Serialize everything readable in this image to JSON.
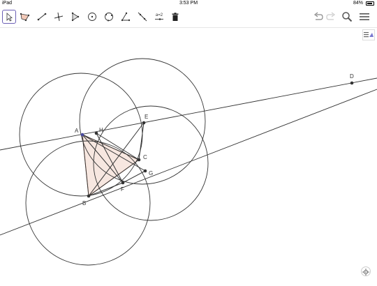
{
  "status_bar": {
    "device": "iPad",
    "time": "3:53 PM",
    "battery_text": "84%",
    "battery_level": 0.84
  },
  "toolbar": {
    "tools": [
      {
        "name": "move-tool-icon"
      },
      {
        "name": "polygon-tool-icon"
      },
      {
        "name": "segment-tool-icon"
      },
      {
        "name": "perpendicular-line-tool-icon"
      },
      {
        "name": "reflect-tool-icon"
      },
      {
        "name": "circle-center-point-tool-icon"
      },
      {
        "name": "circle-three-points-tool-icon"
      },
      {
        "name": "angle-tool-icon"
      },
      {
        "name": "line-tool-icon"
      },
      {
        "name": "slider-tool-icon",
        "text": "a=2"
      },
      {
        "name": "delete-tool-icon"
      }
    ],
    "right_icons": [
      "undo-icon",
      "redo-icon",
      "search-icon",
      "menu-icon"
    ]
  },
  "construction": {
    "points": [
      {
        "label": "A"
      },
      {
        "label": "B"
      },
      {
        "label": "C"
      },
      {
        "label": "D"
      },
      {
        "label": "E"
      },
      {
        "label": "F"
      },
      {
        "label": "G"
      },
      {
        "label": "H"
      }
    ],
    "colors": {
      "stroke": "#333333",
      "triangle_fill": "#f6e3da",
      "triangle_stroke": "#d4896a",
      "point": "#333333",
      "selected_point": "#4a4aa0",
      "accent": "#6b5fb5"
    }
  }
}
